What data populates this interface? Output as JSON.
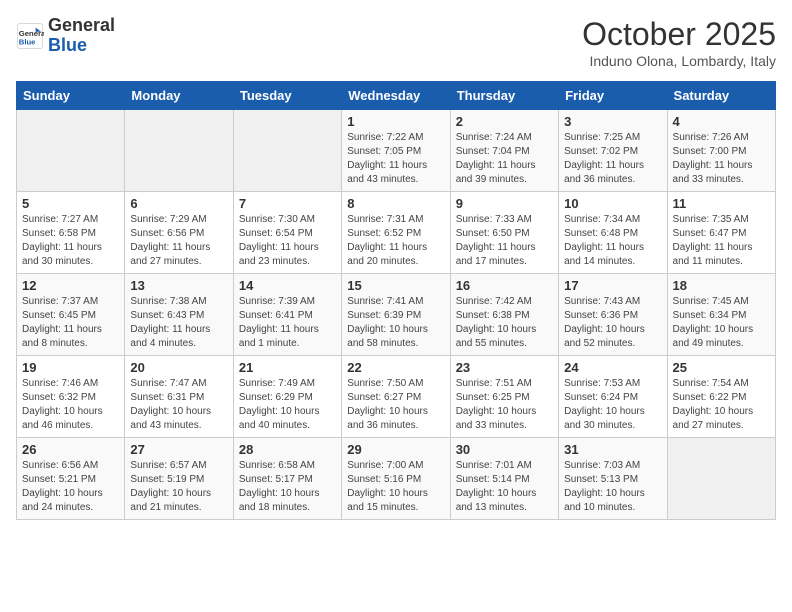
{
  "logo": {
    "line1": "General",
    "line2": "Blue"
  },
  "title": "October 2025",
  "subtitle": "Induno Olona, Lombardy, Italy",
  "days_of_week": [
    "Sunday",
    "Monday",
    "Tuesday",
    "Wednesday",
    "Thursday",
    "Friday",
    "Saturday"
  ],
  "weeks": [
    [
      {
        "day": "",
        "info": ""
      },
      {
        "day": "",
        "info": ""
      },
      {
        "day": "",
        "info": ""
      },
      {
        "day": "1",
        "info": "Sunrise: 7:22 AM\nSunset: 7:05 PM\nDaylight: 11 hours and 43 minutes."
      },
      {
        "day": "2",
        "info": "Sunrise: 7:24 AM\nSunset: 7:04 PM\nDaylight: 11 hours and 39 minutes."
      },
      {
        "day": "3",
        "info": "Sunrise: 7:25 AM\nSunset: 7:02 PM\nDaylight: 11 hours and 36 minutes."
      },
      {
        "day": "4",
        "info": "Sunrise: 7:26 AM\nSunset: 7:00 PM\nDaylight: 11 hours and 33 minutes."
      }
    ],
    [
      {
        "day": "5",
        "info": "Sunrise: 7:27 AM\nSunset: 6:58 PM\nDaylight: 11 hours and 30 minutes."
      },
      {
        "day": "6",
        "info": "Sunrise: 7:29 AM\nSunset: 6:56 PM\nDaylight: 11 hours and 27 minutes."
      },
      {
        "day": "7",
        "info": "Sunrise: 7:30 AM\nSunset: 6:54 PM\nDaylight: 11 hours and 23 minutes."
      },
      {
        "day": "8",
        "info": "Sunrise: 7:31 AM\nSunset: 6:52 PM\nDaylight: 11 hours and 20 minutes."
      },
      {
        "day": "9",
        "info": "Sunrise: 7:33 AM\nSunset: 6:50 PM\nDaylight: 11 hours and 17 minutes."
      },
      {
        "day": "10",
        "info": "Sunrise: 7:34 AM\nSunset: 6:48 PM\nDaylight: 11 hours and 14 minutes."
      },
      {
        "day": "11",
        "info": "Sunrise: 7:35 AM\nSunset: 6:47 PM\nDaylight: 11 hours and 11 minutes."
      }
    ],
    [
      {
        "day": "12",
        "info": "Sunrise: 7:37 AM\nSunset: 6:45 PM\nDaylight: 11 hours and 8 minutes."
      },
      {
        "day": "13",
        "info": "Sunrise: 7:38 AM\nSunset: 6:43 PM\nDaylight: 11 hours and 4 minutes."
      },
      {
        "day": "14",
        "info": "Sunrise: 7:39 AM\nSunset: 6:41 PM\nDaylight: 11 hours and 1 minute."
      },
      {
        "day": "15",
        "info": "Sunrise: 7:41 AM\nSunset: 6:39 PM\nDaylight: 10 hours and 58 minutes."
      },
      {
        "day": "16",
        "info": "Sunrise: 7:42 AM\nSunset: 6:38 PM\nDaylight: 10 hours and 55 minutes."
      },
      {
        "day": "17",
        "info": "Sunrise: 7:43 AM\nSunset: 6:36 PM\nDaylight: 10 hours and 52 minutes."
      },
      {
        "day": "18",
        "info": "Sunrise: 7:45 AM\nSunset: 6:34 PM\nDaylight: 10 hours and 49 minutes."
      }
    ],
    [
      {
        "day": "19",
        "info": "Sunrise: 7:46 AM\nSunset: 6:32 PM\nDaylight: 10 hours and 46 minutes."
      },
      {
        "day": "20",
        "info": "Sunrise: 7:47 AM\nSunset: 6:31 PM\nDaylight: 10 hours and 43 minutes."
      },
      {
        "day": "21",
        "info": "Sunrise: 7:49 AM\nSunset: 6:29 PM\nDaylight: 10 hours and 40 minutes."
      },
      {
        "day": "22",
        "info": "Sunrise: 7:50 AM\nSunset: 6:27 PM\nDaylight: 10 hours and 36 minutes."
      },
      {
        "day": "23",
        "info": "Sunrise: 7:51 AM\nSunset: 6:25 PM\nDaylight: 10 hours and 33 minutes."
      },
      {
        "day": "24",
        "info": "Sunrise: 7:53 AM\nSunset: 6:24 PM\nDaylight: 10 hours and 30 minutes."
      },
      {
        "day": "25",
        "info": "Sunrise: 7:54 AM\nSunset: 6:22 PM\nDaylight: 10 hours and 27 minutes."
      }
    ],
    [
      {
        "day": "26",
        "info": "Sunrise: 6:56 AM\nSunset: 5:21 PM\nDaylight: 10 hours and 24 minutes."
      },
      {
        "day": "27",
        "info": "Sunrise: 6:57 AM\nSunset: 5:19 PM\nDaylight: 10 hours and 21 minutes."
      },
      {
        "day": "28",
        "info": "Sunrise: 6:58 AM\nSunset: 5:17 PM\nDaylight: 10 hours and 18 minutes."
      },
      {
        "day": "29",
        "info": "Sunrise: 7:00 AM\nSunset: 5:16 PM\nDaylight: 10 hours and 15 minutes."
      },
      {
        "day": "30",
        "info": "Sunrise: 7:01 AM\nSunset: 5:14 PM\nDaylight: 10 hours and 13 minutes."
      },
      {
        "day": "31",
        "info": "Sunrise: 7:03 AM\nSunset: 5:13 PM\nDaylight: 10 hours and 10 minutes."
      },
      {
        "day": "",
        "info": ""
      }
    ]
  ]
}
